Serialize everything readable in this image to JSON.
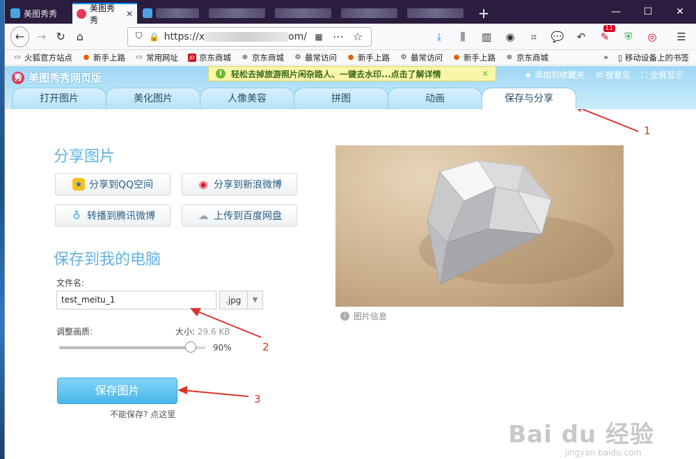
{
  "browser": {
    "tabs": [
      {
        "title": "美图秀秀",
        "active": false
      },
      {
        "title": "美图秀秀",
        "active": true
      }
    ],
    "new_tab_label": "+",
    "window_controls": {
      "minimize": "—",
      "maximize": "☐",
      "close": "✕"
    },
    "url": "https://x",
    "url_tail": "om/",
    "badge_count": "11"
  },
  "bookmarks": [
    {
      "label": "火狐官方站点",
      "icon": "folder-icon"
    },
    {
      "label": "新手上路",
      "icon": "firefox-icon"
    },
    {
      "label": "常用网址",
      "icon": "folder-icon"
    },
    {
      "label": "京东商城",
      "icon": "jd-icon"
    },
    {
      "label": "京东商城",
      "icon": "globe-icon"
    },
    {
      "label": "最常访问",
      "icon": "gear-icon"
    },
    {
      "label": "新手上路",
      "icon": "firefox-icon"
    },
    {
      "label": "最常访问",
      "icon": "gear-icon"
    },
    {
      "label": "新手上路",
      "icon": "firefox-icon"
    },
    {
      "label": "京东商城",
      "icon": "globe-icon"
    }
  ],
  "bookmarks_more": "»",
  "mobile_bookmarks": "移动设备上的书签",
  "page": {
    "brand": "美图秀秀网页版",
    "notice": "轻松去掉旅游照片闲杂路人、一键去水印...点击了解详情",
    "header_links": {
      "favorite": "添加到收藏夹",
      "feedback": "提意见",
      "fullscreen": "全屏显示"
    },
    "tabs": [
      "打开图片",
      "美化图片",
      "人像美容",
      "拼图",
      "动画",
      "保存与分享"
    ],
    "active_tab": "保存与分享"
  },
  "share": {
    "title": "分享图片",
    "buttons": {
      "qzone": "分享到QQ空间",
      "weibo": "分享到新浪微博",
      "tencent": "转播到腾讯微博",
      "baidu": "上传到百度网盘"
    }
  },
  "save": {
    "title": "保存到我的电脑",
    "filename_label": "文件名:",
    "filename_value": "test_meitu_1",
    "ext": ".jpg",
    "quality_label": "调整画质:",
    "size_label": "大小:",
    "size_value": "29.6 KB",
    "quality_percent": "90%",
    "quality_fraction": 0.9,
    "save_button": "保存图片",
    "cant_save": "不能保存? 点这里"
  },
  "image_info": "图片信息",
  "annotations": [
    "1",
    "2",
    "3"
  ],
  "watermark": {
    "main": "Bai du 经验",
    "sub": "jingyan.baidu.com"
  },
  "colors": {
    "accent": "#63b1e0",
    "annotation": "#d9342b",
    "save_button": "#48b5ea"
  }
}
